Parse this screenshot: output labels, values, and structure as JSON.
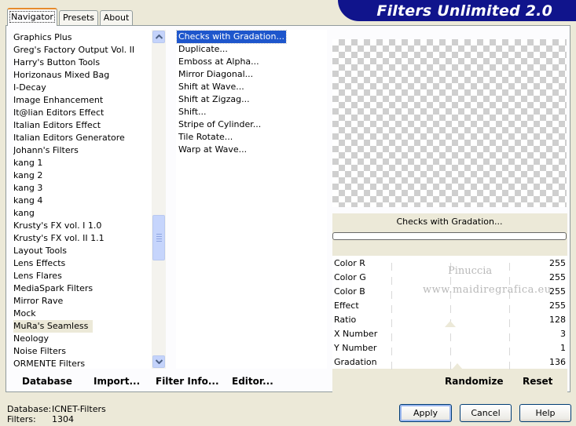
{
  "tabs": [
    {
      "label": "Navigator",
      "active": true
    },
    {
      "label": "Presets",
      "active": false
    },
    {
      "label": "About",
      "active": false
    }
  ],
  "banner": {
    "title": "Filters Unlimited 2.0"
  },
  "categories": [
    "Graphics Plus",
    "Greg's Factory Output Vol. II",
    "Harry's Button Tools",
    "Horizonaus Mixed Bag",
    "I-Decay",
    "Image Enhancement",
    "It@lian Editors Effect",
    "Italian Editors Effect",
    "Italian Editors Generatore",
    "Johann's Filters",
    "kang 1",
    "kang 2",
    "kang 3",
    "kang 4",
    "kang",
    "Krusty's FX vol. I 1.0",
    "Krusty's FX vol. II 1.1",
    "Layout Tools",
    "Lens Effects",
    "Lens Flares",
    "MediaSpark Filters",
    "Mirror Rave",
    "Mock",
    "MuRa's Seamless",
    "Neology",
    "Noise Filters",
    "ORMENTE Filters"
  ],
  "selected_category": "MuRa's Seamless",
  "filters": [
    "Checks with Gradation...",
    "Duplicate...",
    "Emboss at Alpha...",
    "Mirror Diagonal...",
    "Shift at Wave...",
    "Shift at Zigzag...",
    "Shift...",
    "Stripe of Cylinder...",
    "Tile Rotate...",
    "Warp at Wave..."
  ],
  "selected_filter": "Checks with Gradation...",
  "current_filter_name": "Checks with Gradation...",
  "progress": 0,
  "params": [
    {
      "label": "Color R",
      "value": "255"
    },
    {
      "label": "Color G",
      "value": "255"
    },
    {
      "label": "Color B",
      "value": "255"
    },
    {
      "label": "Effect",
      "value": "255"
    },
    {
      "label": "Ratio",
      "value": "128"
    },
    {
      "label": "X Number",
      "value": "3"
    },
    {
      "label": "Y Number",
      "value": "1"
    },
    {
      "label": "Gradation",
      "value": "136"
    }
  ],
  "watermark": {
    "line1": "Pinuccia",
    "line2": "www.maidiregrafica.eu"
  },
  "bottom_links": {
    "database": "Database",
    "import": "Import...",
    "filter_info": "Filter Info...",
    "editor": "Editor...",
    "randomize": "Randomize",
    "reset": "Reset"
  },
  "status": {
    "database_label": "Database:",
    "database_value": "ICNET-Filters",
    "filters_label": "Filters:",
    "filters_value": "1304"
  },
  "buttons": {
    "apply": "Apply",
    "cancel": "Cancel",
    "help": "Help"
  },
  "colors": {
    "banner": "#10148c",
    "selection": "#1e56cc",
    "panel_bg": "#ece9d8"
  }
}
